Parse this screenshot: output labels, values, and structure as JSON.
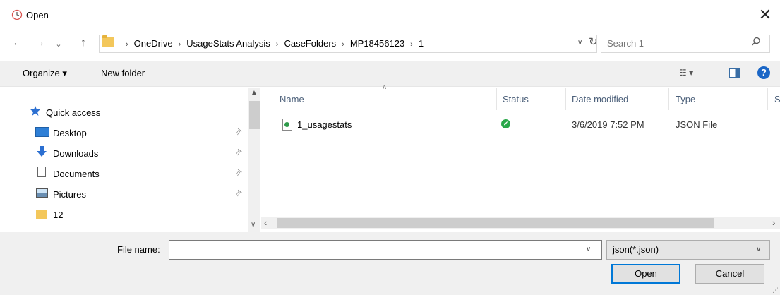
{
  "window": {
    "title": "Open",
    "close": "✕"
  },
  "nav": {
    "back": "←",
    "forward": "→",
    "recent": "⌄",
    "up": "↑",
    "breadcrumb": [
      "OneDrive",
      "UsageStats Analysis",
      "CaseFolders",
      "MP18456123",
      "1"
    ],
    "separator": "›",
    "refresh": "↻",
    "search_placeholder": "Search 1"
  },
  "toolbar": {
    "organize": "Organize ▾",
    "new_folder": "New folder",
    "view": "☷ ▾",
    "help": "?"
  },
  "navpane": {
    "items": [
      {
        "label": "Quick access",
        "icon": "star-icon",
        "pinned": false
      },
      {
        "label": "Desktop",
        "icon": "desktop-icon",
        "pinned": true
      },
      {
        "label": "Downloads",
        "icon": "download-arrow-icon",
        "pinned": true
      },
      {
        "label": "Documents",
        "icon": "document-icon",
        "pinned": true
      },
      {
        "label": "Pictures",
        "icon": "pictures-icon",
        "pinned": true
      },
      {
        "label": "12",
        "icon": "folder-icon",
        "pinned": false
      }
    ],
    "pin_glyph": "📌"
  },
  "filelist": {
    "columns": [
      "Name",
      "Status",
      "Date modified",
      "Type",
      "S"
    ],
    "rows": [
      {
        "name": "1_usagestats",
        "status_icon": "synced-check-icon",
        "date": "3/6/2019 7:52 PM",
        "type": "JSON File"
      }
    ]
  },
  "bottom": {
    "filename_label": "File name:",
    "filename_value": "",
    "filetype": "json(*.json)",
    "open": "Open",
    "cancel": "Cancel"
  },
  "colors": {
    "accent": "#0078d7",
    "folder": "#f3c75b",
    "quick_access_star": "#2b6fd1",
    "status_ok": "#2aa84a",
    "help": "#1a66c6"
  }
}
